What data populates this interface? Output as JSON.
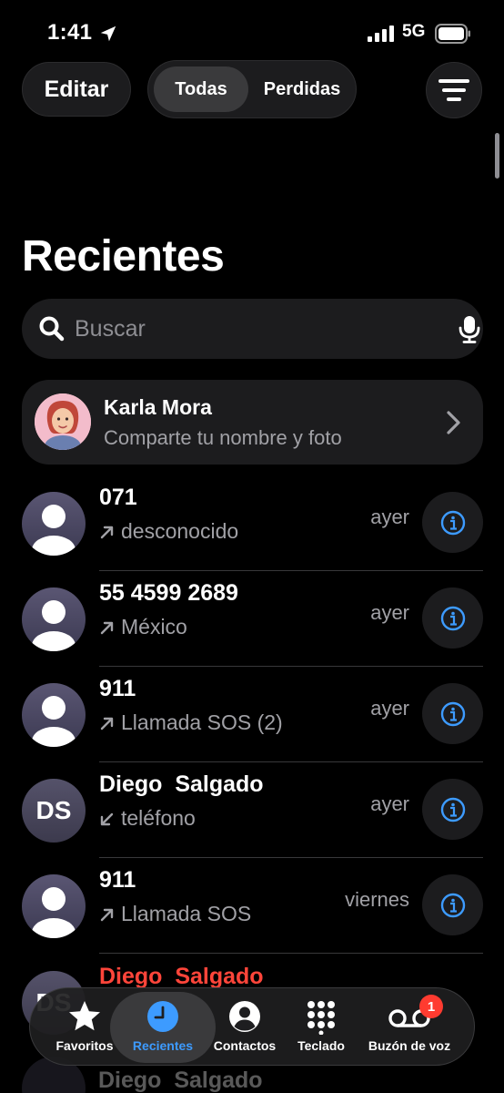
{
  "status": {
    "time": "1:41",
    "network": "5G"
  },
  "toolbar": {
    "edit_label": "Editar",
    "segments": [
      "Todas",
      "Perdidas"
    ],
    "selected_segment": "Todas"
  },
  "page": {
    "title": "Recientes"
  },
  "search": {
    "placeholder": "Buscar"
  },
  "profile": {
    "name": "Karla Mora",
    "subtitle": "Comparte tu nombre y foto"
  },
  "calls": [
    {
      "name": "071",
      "detail": "desconocido",
      "direction": "outgoing",
      "when": "ayer",
      "avatar": "person"
    },
    {
      "name": "55 4599 2689",
      "detail": "México",
      "direction": "outgoing",
      "when": "ayer",
      "avatar": "person"
    },
    {
      "name": "911",
      "detail": "Llamada SOS (2)",
      "direction": "outgoing",
      "when": "ayer",
      "avatar": "person"
    },
    {
      "name": "Diego  Salgado",
      "detail": "teléfono",
      "direction": "incoming",
      "when": "ayer",
      "avatar": "initials",
      "initials": "DS"
    },
    {
      "name": "911",
      "detail": "Llamada SOS",
      "direction": "outgoing",
      "when": "viernes",
      "avatar": "person"
    },
    {
      "name": "Diego  Salgado",
      "missed": true,
      "avatar": "initials",
      "initials": "DS"
    }
  ],
  "ghost_text": "Diego  Salgado",
  "tabbar": {
    "items": [
      {
        "label": "Favoritos",
        "icon": "star-icon"
      },
      {
        "label": "Recientes",
        "icon": "clock-icon",
        "active": true
      },
      {
        "label": "Contactos",
        "icon": "person-circle-icon"
      },
      {
        "label": "Teclado",
        "icon": "keypad-icon"
      },
      {
        "label": "Buzón de voz",
        "icon": "voicemail-icon",
        "badge": "1"
      }
    ]
  },
  "colors": {
    "accent": "#3d9bff",
    "missed": "#ff453a",
    "badge": "#ff3b30",
    "secondary_text": "#a1a1a6"
  }
}
